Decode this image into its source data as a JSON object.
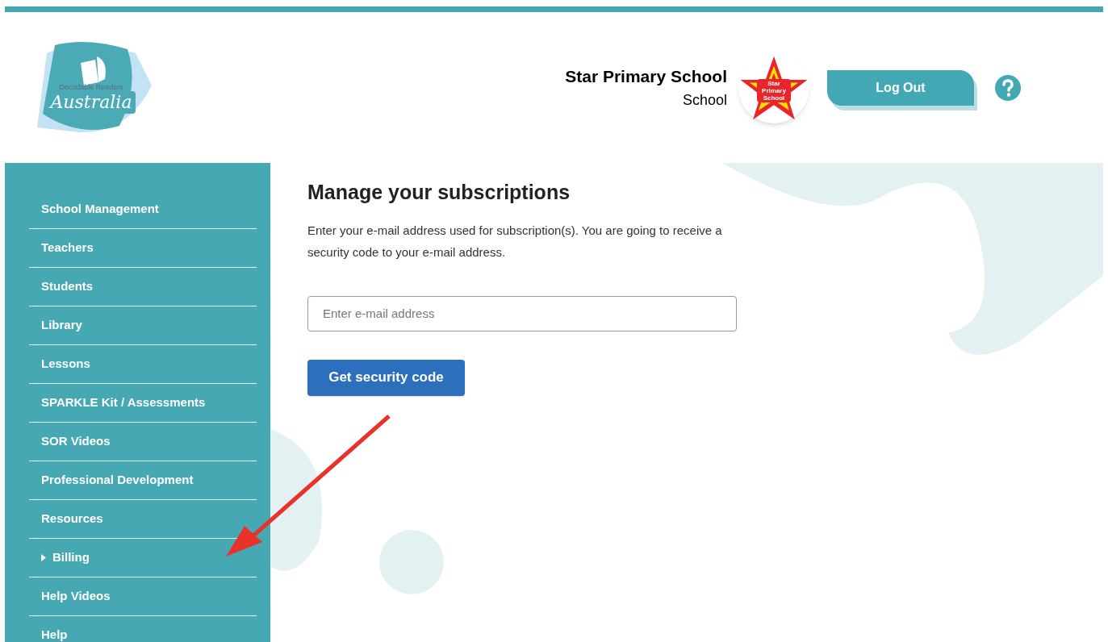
{
  "logo": {
    "tagline": "Decodable Readers",
    "name": "Australia"
  },
  "account": {
    "name": "Star Primary School",
    "role": "School",
    "badge_text": "Star Primary School"
  },
  "header_buttons": {
    "logout": "Log Out"
  },
  "sidebar": {
    "items": [
      {
        "label": "School Management",
        "kind": "link"
      },
      {
        "label": "Teachers",
        "kind": "link"
      },
      {
        "label": "Students",
        "kind": "link"
      },
      {
        "label": "Library",
        "kind": "link"
      },
      {
        "label": "Lessons",
        "kind": "link"
      },
      {
        "label": "SPARKLE Kit / Assessments",
        "kind": "link"
      },
      {
        "label": "SOR Videos",
        "kind": "link"
      },
      {
        "label": "Professional Development",
        "kind": "link"
      },
      {
        "label": "Resources",
        "kind": "link"
      },
      {
        "label": "Billing",
        "kind": "expandable",
        "expanded": false
      },
      {
        "label": "Help Videos",
        "kind": "link"
      },
      {
        "label": "Help",
        "kind": "link"
      }
    ]
  },
  "main": {
    "title": "Manage your subscriptions",
    "description": "Enter your e-mail address used for subscription(s). You are going to receive a security code to your e-mail address.",
    "email_field": {
      "placeholder": "Enter e-mail address"
    },
    "submit": "Get security code"
  }
}
